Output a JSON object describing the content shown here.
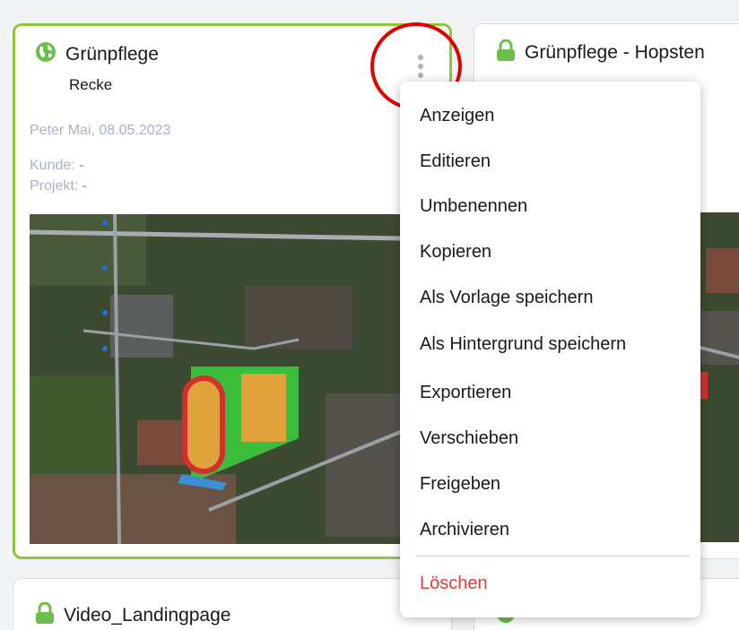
{
  "cards": [
    {
      "title": "Grünpflege",
      "subtitle": "Recke",
      "author_date": "Peter Mai, 08.05.2023",
      "kunde_label": "Kunde:",
      "kunde_value": "-",
      "projekt_label": "Projekt:",
      "projekt_value": "-",
      "icon": "globe-icon",
      "selected": true
    },
    {
      "title": "Grünpflege - Hopsten",
      "icon": "lock-icon"
    },
    {
      "title": "Video_Landingpage",
      "icon": "lock-icon"
    }
  ],
  "menu": {
    "items": [
      "Anzeigen",
      "Editieren",
      "Umbenennen",
      "Kopieren",
      "Als Vorlage speichern",
      "Als Hintergrund speichern",
      "Exportieren",
      "Verschieben",
      "Freigeben",
      "Archivieren"
    ],
    "delete_label": "Löschen"
  },
  "colors": {
    "selected_border": "#8dc63f",
    "icon_green": "#6cc04a",
    "danger": "#e03a3a",
    "annotation_circle": "#e00000"
  }
}
